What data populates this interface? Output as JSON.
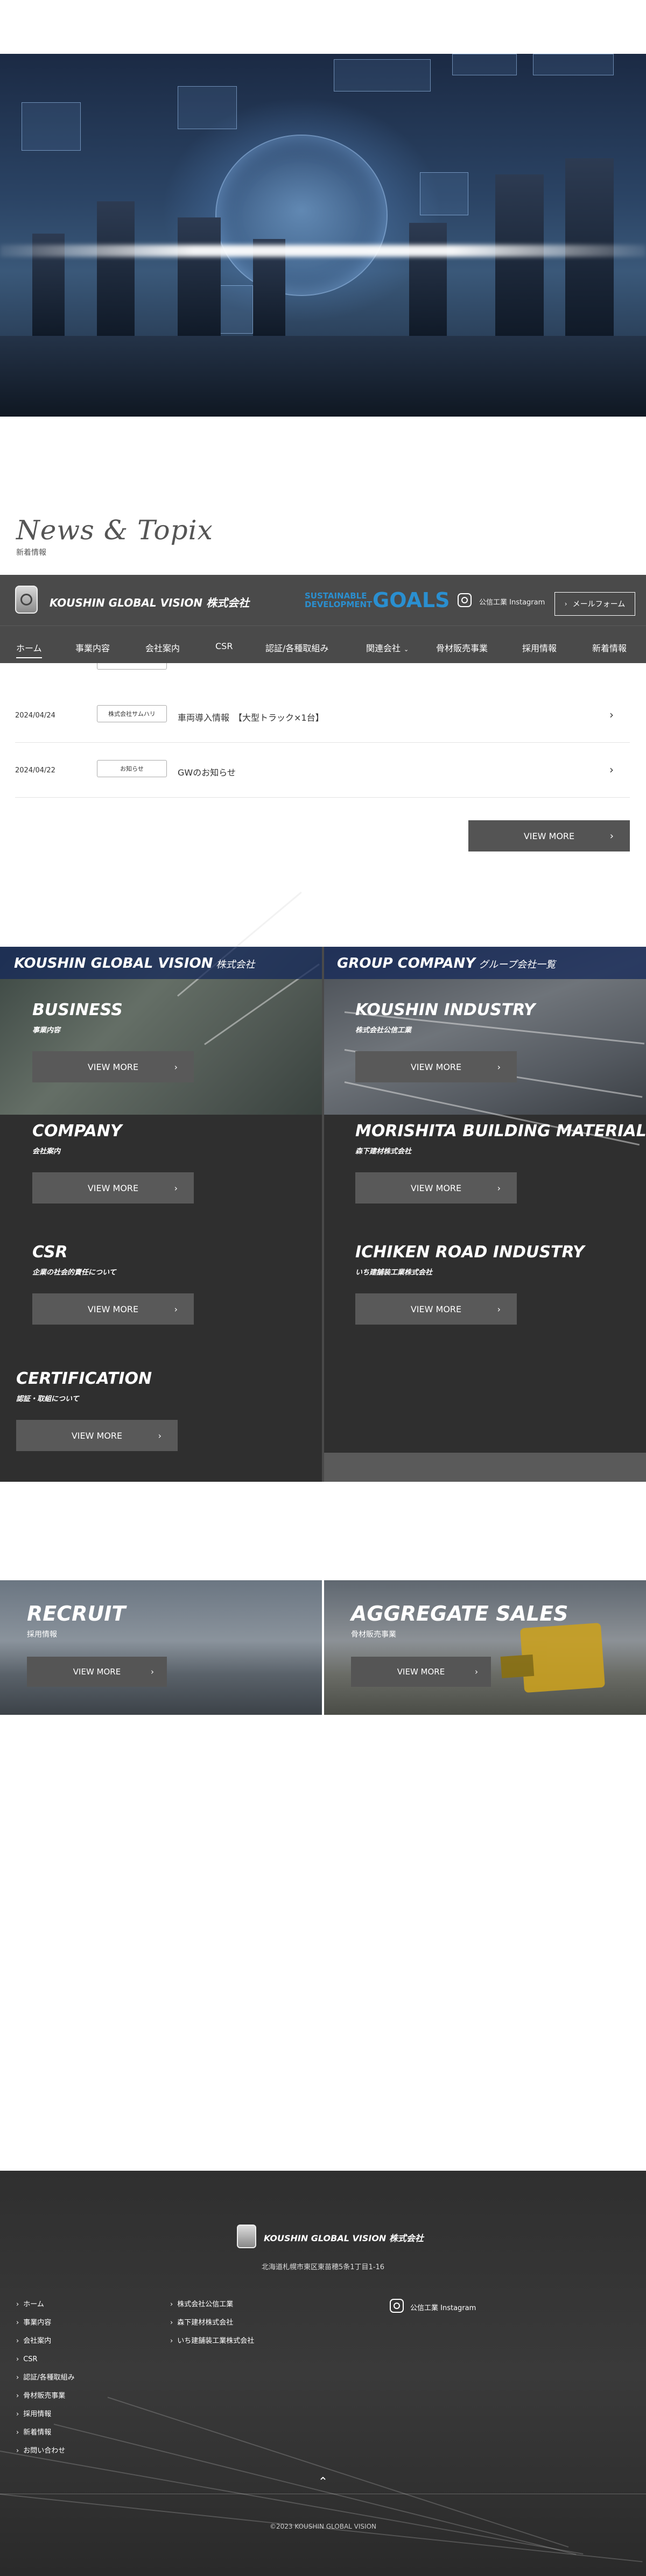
{
  "news": {
    "title": "News & Topix",
    "subtitle": "新着情報",
    "items": [
      {
        "date": "2024/04/24",
        "tag": "株式会社サムハリ",
        "text": "車両導入情報　【大型トラック×1台】"
      },
      {
        "date": "2024/04/22",
        "tag": "お知らせ",
        "text": "GWのお知らせ"
      }
    ],
    "view_more": "VIEW MORE"
  },
  "header": {
    "brand": "KOUSHIN GLOBAL VISION 株式会社",
    "sdgs_line1": "SUSTAINABLE",
    "sdgs_line2": "DEVELOPMENT",
    "sdgs_goals": "GOALS",
    "instagram": "公信工業 Instagram",
    "mail_button": "メールフォーム"
  },
  "nav": {
    "items": [
      "ホーム",
      "事業内容",
      "会社案内",
      "CSR",
      "認証/各種取組み",
      "関連会社",
      "骨材販売事業",
      "採用情報",
      "新着情報"
    ]
  },
  "business": {
    "left_head": "KOUSHIN GLOBAL VISION",
    "left_head_suffix": "株式会社",
    "right_head": "GROUP COMPANY",
    "right_head_suffix": "グループ会社一覧",
    "view_more": "VIEW MORE",
    "left": [
      {
        "title": "BUSINESS",
        "sub": "事業内容"
      },
      {
        "title": "COMPANY",
        "sub": "会社案内"
      },
      {
        "title": "CSR",
        "sub": "企業の社会的責任について"
      },
      {
        "title": "CERTIFICATION",
        "sub": "認証・取組について"
      }
    ],
    "right": [
      {
        "title": "KOUSHIN INDUSTRY",
        "sub": "株式会社公信工業"
      },
      {
        "title": "MORISHITA BUILDING MATERIALS",
        "sub": "森下建材株式会社"
      },
      {
        "title": "ICHIKEN ROAD INDUSTRY",
        "sub": "いち建舗装工業株式会社"
      }
    ]
  },
  "recruit": {
    "title": "RECRUIT",
    "sub": "採用情報",
    "view_more": "VIEW MORE"
  },
  "aggregate": {
    "title": "AGGREGATE SALES",
    "sub": "骨材販売事業",
    "view_more": "VIEW MORE"
  },
  "footer": {
    "brand": "KOUSHIN GLOBAL VISION 株式会社",
    "address": "北海道札幌市東区東苗穂5条1丁目1-16",
    "links_col1": [
      "ホーム",
      "事業内容",
      "会社案内",
      "CSR",
      "認証/各種取組み",
      "骨材販売事業",
      "採用情報",
      "新着情報",
      "お問い合わせ"
    ],
    "links_col2": [
      "株式会社公信工業",
      "森下建材株式会社",
      "いち建舗装工業株式会社"
    ],
    "instagram": "公信工業 Instagram",
    "copyright": "©2023 KOUSHIN GLOBAL VISION"
  }
}
